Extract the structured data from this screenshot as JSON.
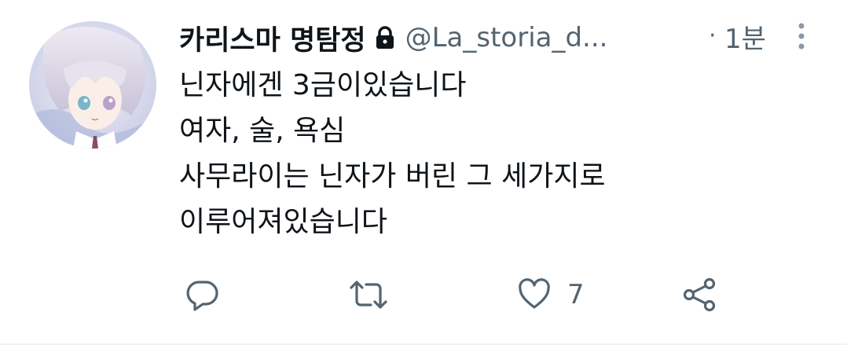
{
  "tweet": {
    "display_name": "카리스마 명탐정",
    "handle": "@La_storia_d...",
    "dot": "·",
    "time": "1분",
    "lines": [
      "닌자에겐 3금이있습니다",
      "여자, 술, 욕심",
      "사무라이는 닌자가 버린 그 세가지로",
      "이루어져있습니다"
    ],
    "protected_icon": "lock-icon",
    "more_icon": "vertical-ellipsis-icon"
  },
  "actions": {
    "reply_icon": "reply-icon",
    "retweet_icon": "retweet-icon",
    "like_icon": "heart-icon",
    "like_count": "7",
    "share_icon": "share-icon"
  },
  "colors": {
    "text": "#0f1419",
    "secondary": "#536471",
    "divider": "#eff3f4"
  }
}
